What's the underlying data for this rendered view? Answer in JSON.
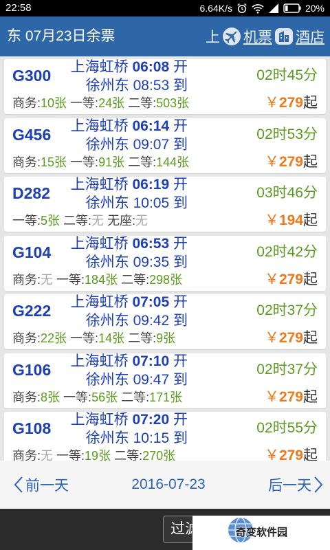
{
  "status_bar": {
    "time": "22:58",
    "net_speed": "6.64K/s",
    "battery": "20%",
    "icons": [
      "alarm-icon",
      "wifi-icon",
      "signal-icon",
      "battery-icon"
    ]
  },
  "header": {
    "title": "东 07月23日余票",
    "marquee_fragment": "上",
    "flight_label": "机票",
    "hotel_label": "酒店",
    "icons": [
      "plane-icon",
      "hotel-icon"
    ]
  },
  "trains": [
    {
      "number": "G300",
      "from": "上海虹桥",
      "depart": "06:08",
      "depart_suffix": "开",
      "to": "徐州东",
      "arrive": "08:53",
      "arrive_suffix": "到",
      "duration": "02时45分",
      "seats": [
        {
          "label": "商务:",
          "count": "10张"
        },
        {
          "label": "一等:",
          "count": "24张"
        },
        {
          "label": "二等:",
          "count": "503张"
        }
      ],
      "price_symbol": "￥",
      "price": "279",
      "price_suffix": "起"
    },
    {
      "number": "G456",
      "from": "上海虹桥",
      "depart": "06:14",
      "depart_suffix": "开",
      "to": "徐州东",
      "arrive": "09:07",
      "arrive_suffix": "到",
      "duration": "02时53分",
      "seats": [
        {
          "label": "商务:",
          "count": "15张"
        },
        {
          "label": "一等:",
          "count": "91张"
        },
        {
          "label": "二等:",
          "count": "144张"
        }
      ],
      "price_symbol": "￥",
      "price": "279",
      "price_suffix": "起"
    },
    {
      "number": "D282",
      "from": "上海虹桥",
      "depart": "06:19",
      "depart_suffix": "开",
      "to": "徐州东",
      "arrive": "10:05",
      "arrive_suffix": "到",
      "duration": "03时46分",
      "seats": [
        {
          "label": "一等:",
          "count": "5张"
        },
        {
          "label": "二等:",
          "count": "无"
        },
        {
          "label": "无座:",
          "count": "无"
        }
      ],
      "price_symbol": "￥",
      "price": "194",
      "price_suffix": "起"
    },
    {
      "number": "G104",
      "from": "上海虹桥",
      "depart": "06:53",
      "depart_suffix": "开",
      "to": "徐州东",
      "arrive": "09:35",
      "arrive_suffix": "到",
      "duration": "02时42分",
      "seats": [
        {
          "label": "商务:",
          "count": "无"
        },
        {
          "label": "一等:",
          "count": "184张"
        },
        {
          "label": "二等:",
          "count": "298张"
        }
      ],
      "price_symbol": "￥",
      "price": "279",
      "price_suffix": "起"
    },
    {
      "number": "G222",
      "from": "上海虹桥",
      "depart": "07:05",
      "depart_suffix": "开",
      "to": "徐州东",
      "arrive": "09:42",
      "arrive_suffix": "到",
      "duration": "02时37分",
      "seats": [
        {
          "label": "商务:",
          "count": "22张"
        },
        {
          "label": "一等:",
          "count": "14张"
        },
        {
          "label": "二等:",
          "count": "9张"
        }
      ],
      "price_symbol": "￥",
      "price": "279",
      "price_suffix": "起"
    },
    {
      "number": "G106",
      "from": "上海虹桥",
      "depart": "07:10",
      "depart_suffix": "开",
      "to": "徐州东",
      "arrive": "09:47",
      "arrive_suffix": "到",
      "duration": "02时37分",
      "seats": [
        {
          "label": "商务:",
          "count": "8张"
        },
        {
          "label": "一等:",
          "count": "56张"
        },
        {
          "label": "二等:",
          "count": "171张"
        }
      ],
      "price_symbol": "￥",
      "price": "279",
      "price_suffix": "起"
    },
    {
      "number": "G108",
      "from": "上海虹桥",
      "depart": "07:20",
      "depart_suffix": "开",
      "to": "徐州东",
      "arrive": "10:15",
      "arrive_suffix": "到",
      "duration": "02时55分",
      "seats": [
        {
          "label": "商务:",
          "count": "无"
        },
        {
          "label": "一等:",
          "count": "19张"
        },
        {
          "label": "二等:",
          "count": "270张"
        }
      ],
      "price_symbol": "￥",
      "price": "279",
      "price_suffix": "起"
    }
  ],
  "footer": {
    "prev": "前一天",
    "date": "2016-07-23",
    "next": "后一天",
    "icons": [
      "chevron-left-icon",
      "chevron-right-icon"
    ]
  },
  "toolbar": {
    "filter": "过滤"
  },
  "watermark": {
    "text": "奇变软件园",
    "icon": "globe-icon"
  },
  "colors": {
    "header_bg": "#2e67a7",
    "train_blue": "#1d3fb6",
    "duration_green": "#5a9b1d",
    "seat_green": "#5a9b1d",
    "price_orange": "#f07818",
    "unavailable_gray": "#a8a8a8",
    "footer_blue": "#2a63b8"
  }
}
